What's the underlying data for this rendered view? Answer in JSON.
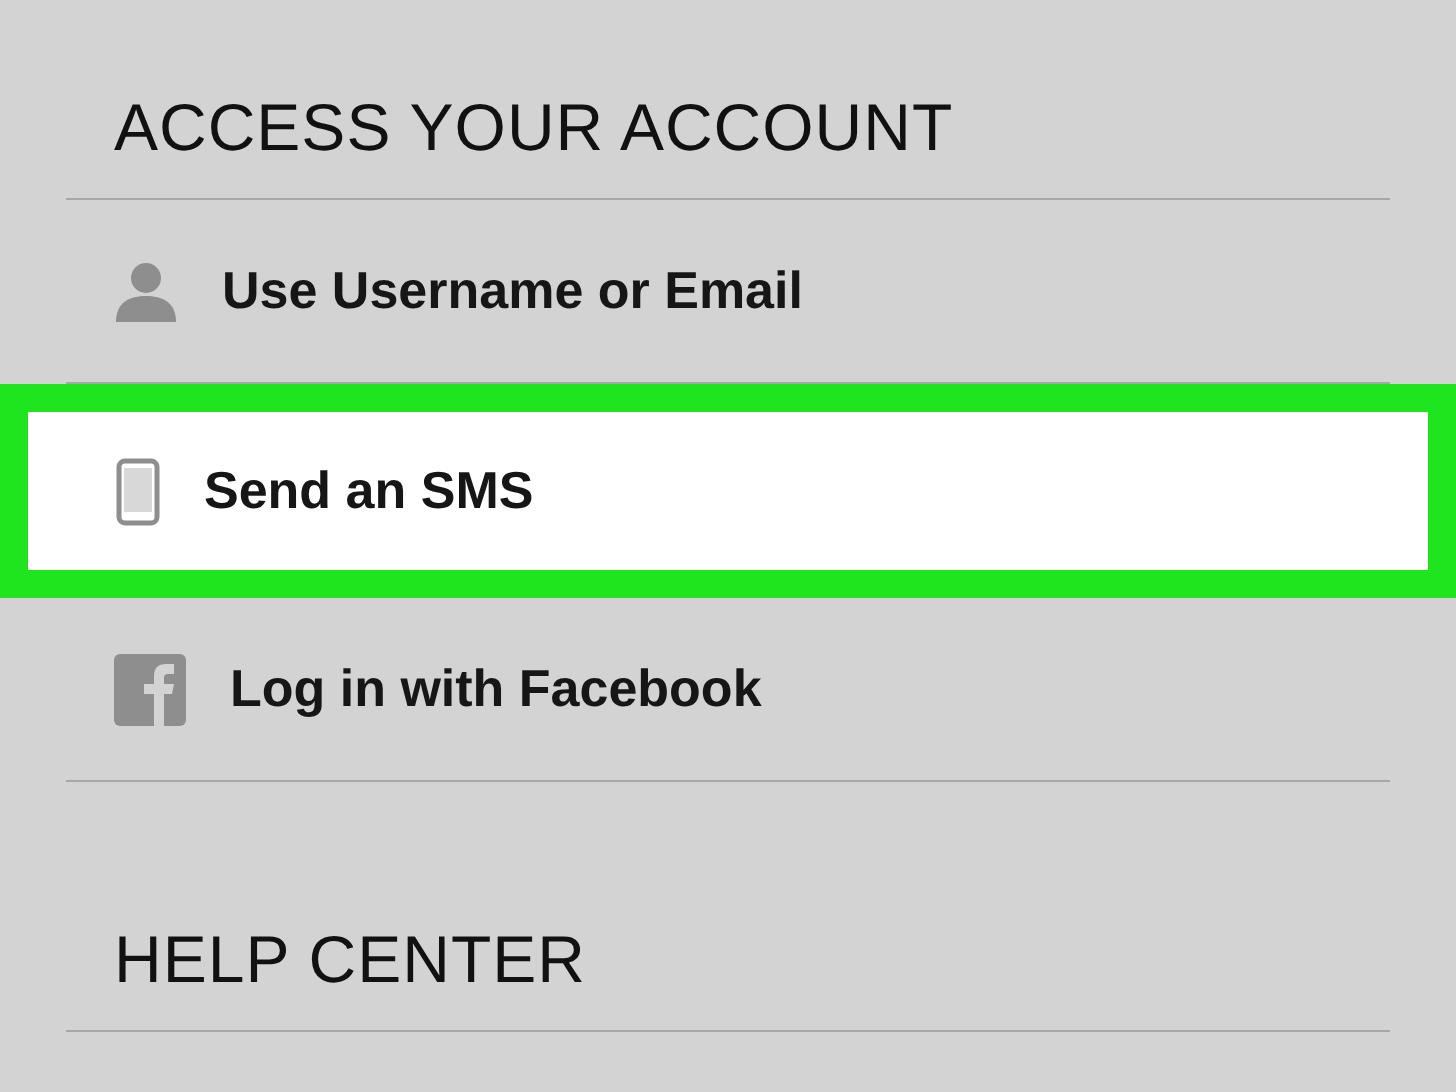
{
  "sections": [
    {
      "title": "ACCESS YOUR ACCOUNT",
      "items": [
        {
          "kind": "person",
          "label": "Use Username or Email",
          "selected": false
        },
        {
          "kind": "phone",
          "label": "Send an SMS",
          "selected": true
        },
        {
          "kind": "facebook",
          "label": "Log in with Facebook",
          "selected": false
        }
      ]
    },
    {
      "title": "HELP CENTER"
    }
  ]
}
